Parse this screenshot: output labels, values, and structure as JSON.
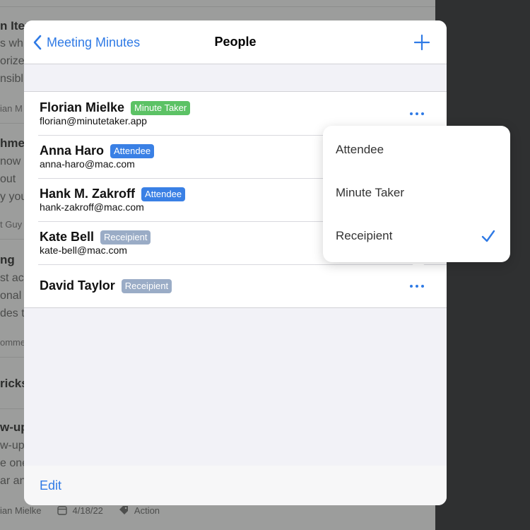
{
  "background": {
    "fragments": [
      "n Iter",
      "s wh",
      "orize",
      "nsibl",
      "ian M",
      "hme",
      "now",
      "out",
      "y you",
      "t Guy",
      "ng",
      "st ac",
      "onal",
      "des t",
      "omme",
      "ricks",
      "w-up",
      "w-ups",
      "e one",
      "ar an"
    ],
    "meta": {
      "author": "ian Mielke",
      "date": "4/18/22",
      "tag": "Action"
    }
  },
  "navbar": {
    "back_label": "Meeting Minutes",
    "title": "People"
  },
  "people": [
    {
      "name": "Florian Mielke",
      "role": "Minute Taker",
      "role_color": "green",
      "email": "florian@minutetaker.app"
    },
    {
      "name": "Anna Haro",
      "role": "Attendee",
      "role_color": "blue",
      "email": "anna-haro@mac.com"
    },
    {
      "name": "Hank M. Zakroff",
      "role": "Attendee",
      "role_color": "blue",
      "email": "hank-zakroff@mac.com"
    },
    {
      "name": "Kate Bell",
      "role": "Receipient",
      "role_color": "grey",
      "email": "kate-bell@mac.com"
    },
    {
      "name": "David Taylor",
      "role": "Receipient",
      "role_color": "grey",
      "email": ""
    }
  ],
  "popover": {
    "options": [
      "Attendee",
      "Minute Taker",
      "Receipient"
    ],
    "selected": "Receipient"
  },
  "toolbar": {
    "edit_label": "Edit"
  },
  "colors": {
    "accent": "#2f7ae5",
    "badge_green": "#5cc265",
    "badge_blue": "#3a80e5",
    "badge_grey": "#9aacc6"
  }
}
